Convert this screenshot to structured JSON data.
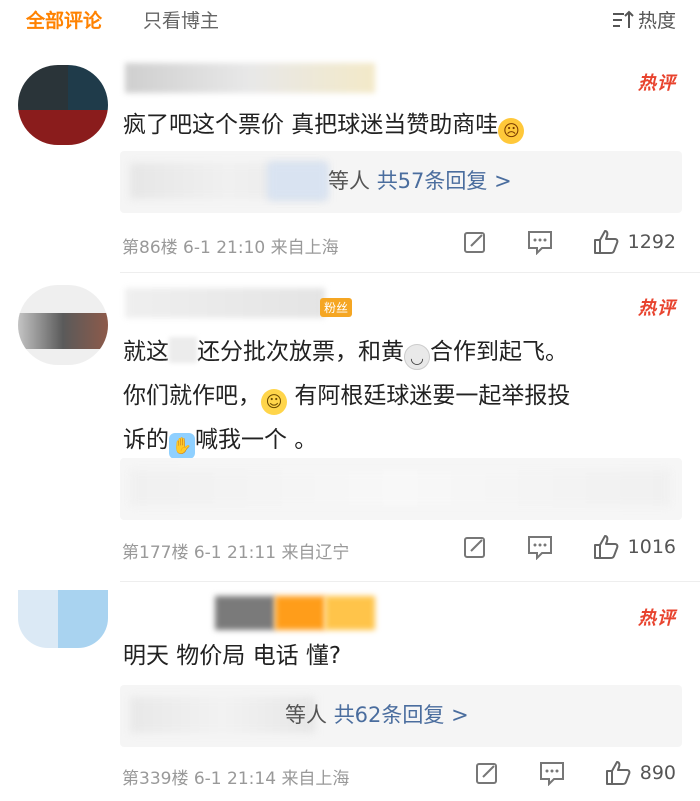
{
  "tabs": {
    "all_comments": "全部评论",
    "author_only": "只看博主",
    "sort_label": "热度"
  },
  "colors": {
    "accent": "#ff8200",
    "hot_badge": "#e8432e",
    "link": "#4a6d9e"
  },
  "comments": [
    {
      "hot_label": "热评",
      "text": "疯了吧这个票价 真把球迷当赞助商哇",
      "emoji": "shocked-face-emoji",
      "reply_pre": "等人",
      "reply_label": "共57条回复 >",
      "floor": "第86楼",
      "date": "6-1 21:10",
      "location": "来自上海",
      "likes": "1292"
    },
    {
      "hot_label": "热评",
      "badge": "粉丝",
      "text_a": "就这",
      "text_b": "还分批次放票，和黄",
      "text_c": "合作到起飞。",
      "text_d": "你们就作吧，",
      "text_e": "有阿根廷球迷要一起举报投",
      "text_f": "诉的",
      "text_g": "喊我一个 。",
      "floor": "第177楼",
      "date": "6-1 21:11",
      "location": "来自辽宁",
      "likes": "1016"
    },
    {
      "hot_label": "热评",
      "text": "明天 物价局 电话 懂?",
      "reply_pre": "等人",
      "reply_label": "共62条回复 >",
      "floor": "第339楼",
      "date": "6-1 21:14",
      "location": "来自上海",
      "likes": "890"
    }
  ]
}
